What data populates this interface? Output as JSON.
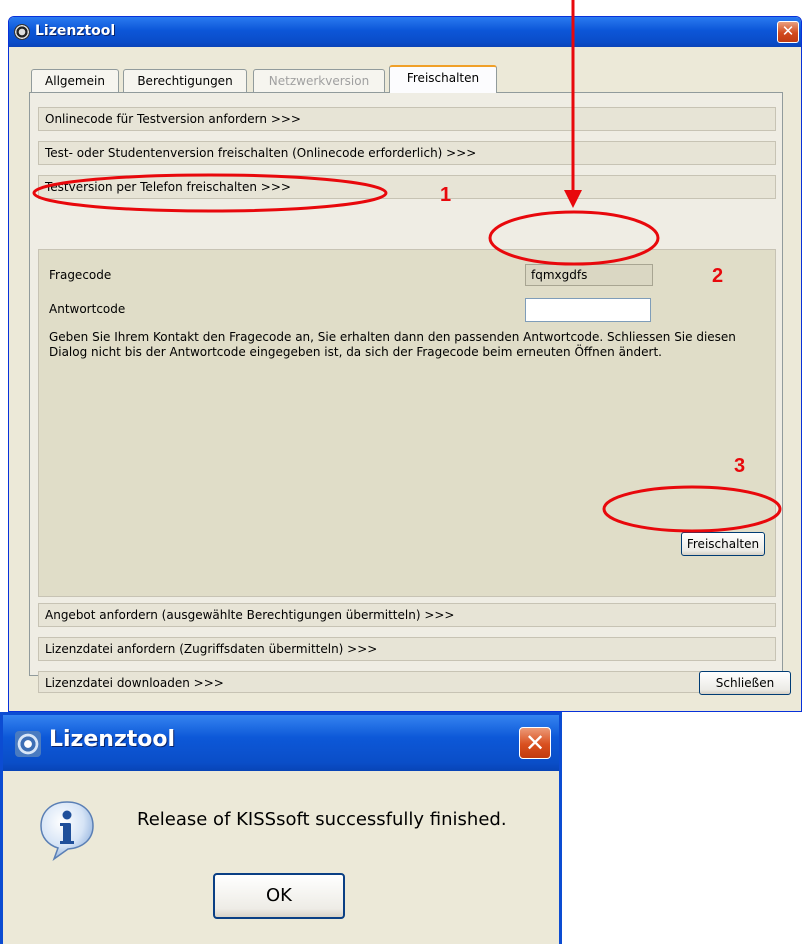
{
  "main_window": {
    "title": "Lizenztool",
    "close_glyph": "✕",
    "tabs": [
      {
        "label": "Allgemein",
        "state": "normal"
      },
      {
        "label": "Berechtigungen",
        "state": "normal"
      },
      {
        "label": "Netzwerkversion",
        "state": "disabled"
      },
      {
        "label": "Freischalten",
        "state": "active"
      }
    ],
    "sections": {
      "online_code": "Onlinecode für Testversion anfordern >>>",
      "unlock_student": "Test- oder Studentenversion freischalten (Onlinecode erforderlich) >>>",
      "unlock_phone": "Testversion per Telefon freischalten >>>",
      "request_offer": "Angebot anfordern (ausgewählte Berechtigungen übermitteln) >>>",
      "request_license": "Lizenzdatei anfordern (Zugriffsdaten übermitteln) >>>",
      "download_license": "Lizenzdatei downloaden >>>"
    },
    "phone_unlock": {
      "question_label": "Fragecode",
      "question_value": "fqmxgdfs",
      "answer_label": "Antwortcode",
      "answer_value": "",
      "help_text": "Geben Sie Ihrem Kontakt den Fragecode an, Sie erhalten dann den passenden Antwortcode. Schliessen Sie diesen Dialog nicht bis der Antwortcode eingegeben ist, da sich der Fragecode beim erneuten Öffnen ändert.",
      "unlock_button": "Freischalten"
    },
    "close_button": "Schließen"
  },
  "message_box": {
    "title": "Lizenztool",
    "close_glyph": "✕",
    "icon": "info-icon",
    "message": "Release of KISSsoft successfully finished.",
    "ok_button": "OK"
  },
  "annotations": {
    "color": "#e8080c",
    "step_1": "1",
    "step_2": "2",
    "step_3": "3"
  }
}
